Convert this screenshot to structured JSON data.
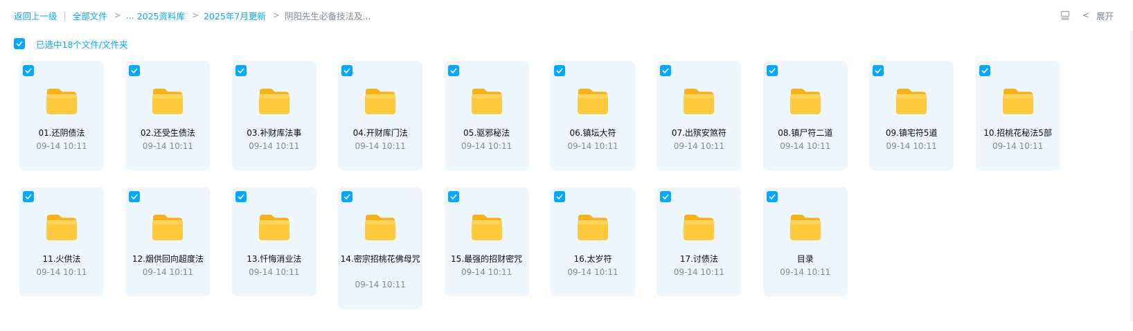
{
  "breadcrumb": {
    "back": "返回上一级",
    "all_files": "全部文件",
    "ellipsis": "...",
    "crumb1": "2025资料库",
    "crumb2": "2025年7月更新",
    "current": "阴阳先生必备技法及..."
  },
  "top_right": {
    "view_icon": "list-view-icon",
    "expand_label": "展开"
  },
  "selection": {
    "checked": true,
    "label": "已选中18个文件/文件夹"
  },
  "colors": {
    "accent": "#06a7ff",
    "card_bg": "#eef7fe",
    "folder": "#ffc93d"
  },
  "items": [
    {
      "name": "01.还阴债法",
      "time": "09-14 10:11"
    },
    {
      "name": "02.还受生债法",
      "time": "09-14 10:11"
    },
    {
      "name": "03.补财库法事",
      "time": "09-14 10:11"
    },
    {
      "name": "04.开财库门法",
      "time": "09-14 10:11"
    },
    {
      "name": "05.驱邪秘法",
      "time": "09-14 10:11"
    },
    {
      "name": "06.镇坛大符",
      "time": "09-14 10:11"
    },
    {
      "name": "07.出殡安煞符",
      "time": "09-14 10:11"
    },
    {
      "name": "08.镇尸符二道",
      "time": "09-14 10:11"
    },
    {
      "name": "09.镇宅符5道",
      "time": "09-14 10:11"
    },
    {
      "name": "10.招桃花秘法5部",
      "time": "09-14 10:11"
    },
    {
      "name": "11.火供法",
      "time": "09-14 10:11"
    },
    {
      "name": "12.烟供回向超度法",
      "time": "09-14 10:11"
    },
    {
      "name": "13.忏悔消业法",
      "time": "09-14 10:11"
    },
    {
      "name": "14.密宗招桃花佛母咒",
      "time": "09-14 10:11"
    },
    {
      "name": "15.最强的招财密咒",
      "time": "09-14 10:11"
    },
    {
      "name": "16.太岁符",
      "time": "09-14 10:11"
    },
    {
      "name": "17.讨债法",
      "time": "09-14 10:11"
    },
    {
      "name": "目录",
      "time": "09-14 10:11"
    }
  ]
}
